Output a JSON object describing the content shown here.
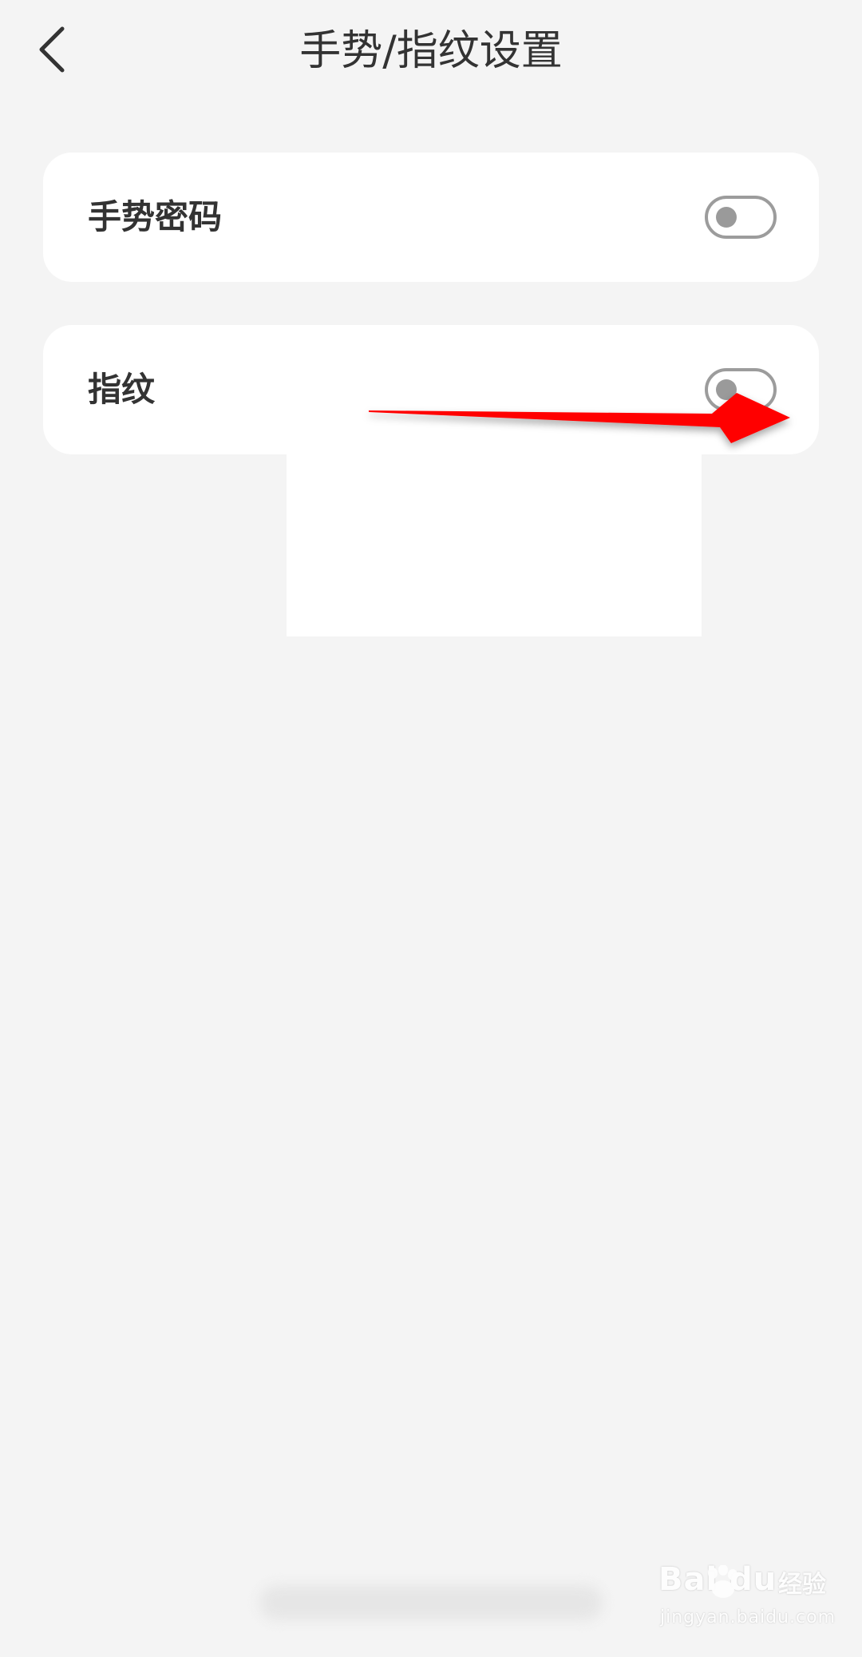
{
  "header": {
    "title": "手势/指纹设置",
    "back_icon": "chevron-left-icon"
  },
  "settings": [
    {
      "label": "手势密码",
      "enabled": false
    },
    {
      "label": "指纹",
      "enabled": false
    }
  ],
  "annotation": {
    "arrow_color": "#ff0000",
    "arrow_icon": "red-arrow-icon"
  },
  "watermark": {
    "logo_text": "Bai du",
    "brand_text": "经验",
    "site_text": "jingyan.baidu.com"
  },
  "colors": {
    "background": "#f4f4f4",
    "card": "#ffffff",
    "text": "#333333",
    "toggle_off": "#9c9c9c"
  }
}
